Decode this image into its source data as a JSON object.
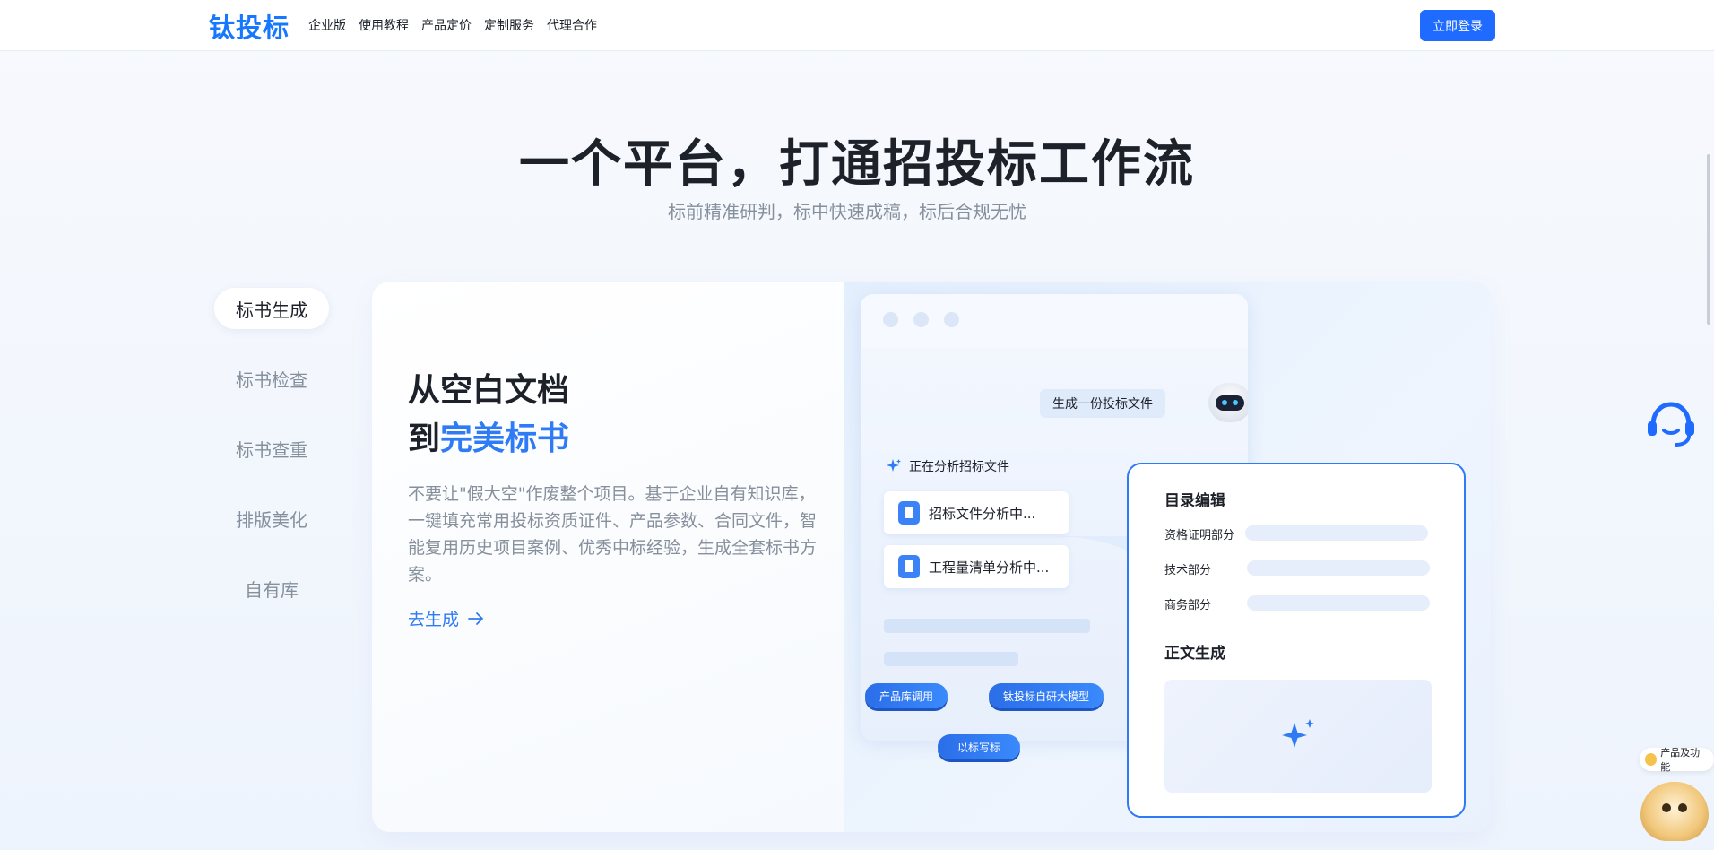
{
  "header": {
    "logo": "钛投标",
    "nav": [
      "企业版",
      "使用教程",
      "产品定价",
      "定制服务",
      "代理合作"
    ],
    "login_label": "立即登录"
  },
  "hero": {
    "title": "一个平台，打通招投标工作流",
    "subtitle": "标前精准研判，标中快速成稿，标后合规无忧"
  },
  "tabs": [
    "标书生成",
    "标书检查",
    "标书查重",
    "排版美化",
    "自有库"
  ],
  "card": {
    "title_line1": "从空白文档",
    "title_line2_prefix": "到",
    "title_line2_highlight": "完美标书",
    "description": "不要让\"假大空\"作废整个项目。基于企业自有知识库，一键填充常用投标资质证件、产品参数、合同文件，智能复用历史项目案例、优秀中标经验，生成全套标书方案。",
    "cta_label": "去生成",
    "cta_icon": "arrow-right-icon"
  },
  "mock": {
    "request": "生成一份投标文件",
    "analyzing": "正在分析招标文件",
    "files": [
      "招标文件分析中...",
      "工程量清单分析中..."
    ],
    "pills": [
      "产品库调用",
      "钛投标自研大模型",
      "以标写标"
    ]
  },
  "toc": {
    "title": "目录编辑",
    "rows": [
      "资格证明部分",
      "技术部分",
      "商务部分"
    ],
    "gen_title": "正文生成"
  },
  "floating": {
    "product_tag": "产品及功能"
  },
  "colors": {
    "brand": "#1f6bff",
    "accent": "#2f7bf5",
    "muted_text": "#86909c"
  }
}
